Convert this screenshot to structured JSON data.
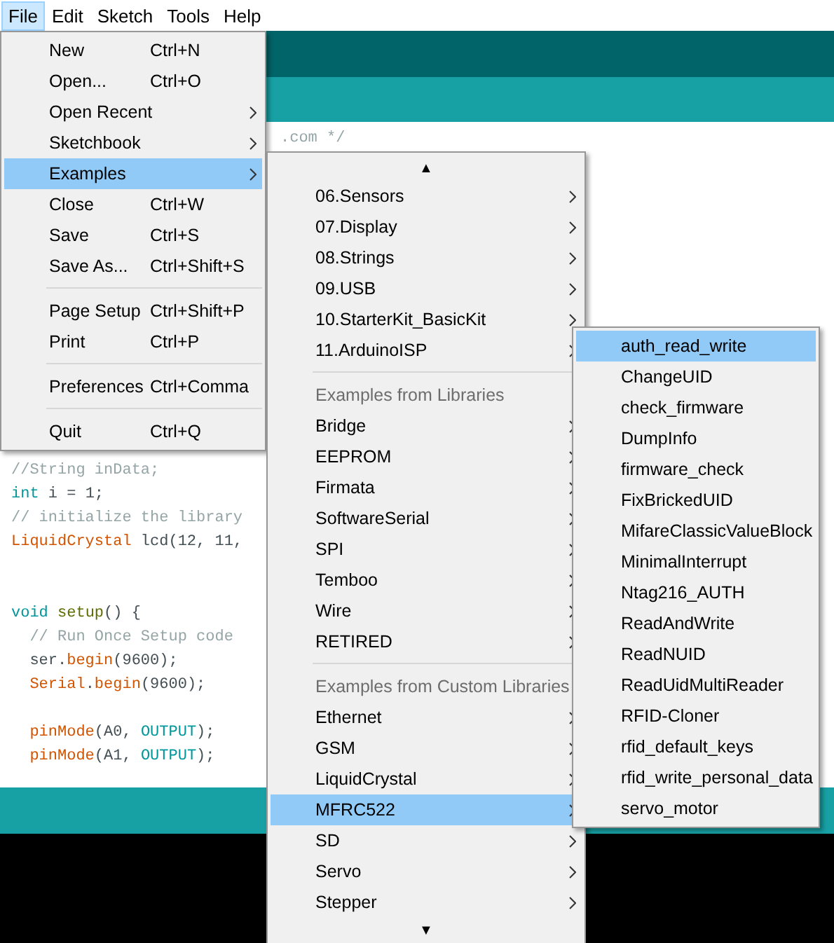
{
  "menubar": [
    {
      "label": "File",
      "selected": true
    },
    {
      "label": "Edit",
      "selected": false
    },
    {
      "label": "Sketch",
      "selected": false
    },
    {
      "label": "Tools",
      "selected": false
    },
    {
      "label": "Help",
      "selected": false
    }
  ],
  "editor": {
    "top_line": [
      {
        "kind": "comment",
        "text": ".com */"
      }
    ],
    "lines": [
      {
        "kind": "code",
        "tokens": [
          {
            "kind": "comment",
            "text": "//String inData;"
          }
        ]
      },
      {
        "kind": "code",
        "tokens": [
          {
            "kind": "keyword",
            "text": "int"
          },
          {
            "kind": "plain",
            "text": " i = 1;"
          }
        ]
      },
      {
        "kind": "code",
        "tokens": [
          {
            "kind": "comment",
            "text": "// initialize the library"
          }
        ]
      },
      {
        "kind": "code",
        "tokens": [
          {
            "kind": "class",
            "text": "LiquidCrystal"
          },
          {
            "kind": "plain",
            "text": " lcd(12, 11,"
          }
        ]
      },
      {
        "kind": "blank"
      },
      {
        "kind": "blank"
      },
      {
        "kind": "code",
        "tokens": [
          {
            "kind": "keyword",
            "text": "void "
          },
          {
            "kind": "function",
            "text": "setup"
          },
          {
            "kind": "plain",
            "text": "() {"
          }
        ]
      },
      {
        "kind": "code",
        "tokens": [
          {
            "kind": "comment",
            "text": "  // Run Once Setup code"
          }
        ]
      },
      {
        "kind": "code",
        "tokens": [
          {
            "kind": "plain",
            "text": "  ser."
          },
          {
            "kind": "class",
            "text": "begin"
          },
          {
            "kind": "plain",
            "text": "(9600);"
          }
        ]
      },
      {
        "kind": "code",
        "tokens": [
          {
            "kind": "class",
            "text": "  Serial"
          },
          {
            "kind": "plain",
            "text": "."
          },
          {
            "kind": "class",
            "text": "begin"
          },
          {
            "kind": "plain",
            "text": "(9600);"
          }
        ]
      },
      {
        "kind": "blank"
      },
      {
        "kind": "code",
        "tokens": [
          {
            "kind": "class",
            "text": "  pinMode"
          },
          {
            "kind": "plain",
            "text": "(A0, "
          },
          {
            "kind": "keyword",
            "text": "OUTPUT"
          },
          {
            "kind": "plain",
            "text": ");"
          }
        ]
      },
      {
        "kind": "code",
        "tokens": [
          {
            "kind": "class",
            "text": "  pinMode"
          },
          {
            "kind": "plain",
            "text": "(A1, "
          },
          {
            "kind": "keyword",
            "text": "OUTPUT"
          },
          {
            "kind": "plain",
            "text": ");"
          }
        ]
      }
    ]
  },
  "file_menu": {
    "items": [
      {
        "kind": "item",
        "label": "New",
        "shortcut": "Ctrl+N",
        "submenu": false,
        "selected": false
      },
      {
        "kind": "item",
        "label": "Open...",
        "shortcut": "Ctrl+O",
        "submenu": false,
        "selected": false
      },
      {
        "kind": "item",
        "label": "Open Recent",
        "submenu": true,
        "selected": false
      },
      {
        "kind": "item",
        "label": "Sketchbook",
        "submenu": true,
        "selected": false
      },
      {
        "kind": "item",
        "label": "Examples",
        "submenu": true,
        "selected": true
      },
      {
        "kind": "item",
        "label": "Close",
        "shortcut": "Ctrl+W",
        "submenu": false,
        "selected": false
      },
      {
        "kind": "item",
        "label": "Save",
        "shortcut": "Ctrl+S",
        "submenu": false,
        "selected": false
      },
      {
        "kind": "item",
        "label": "Save As...",
        "shortcut": "Ctrl+Shift+S",
        "submenu": false,
        "selected": false
      },
      {
        "kind": "separator"
      },
      {
        "kind": "item",
        "label": "Page Setup",
        "shortcut": "Ctrl+Shift+P",
        "submenu": false,
        "selected": false
      },
      {
        "kind": "item",
        "label": "Print",
        "shortcut": "Ctrl+P",
        "submenu": false,
        "selected": false
      },
      {
        "kind": "separator"
      },
      {
        "kind": "item",
        "label": "Preferences",
        "shortcut": "Ctrl+Comma",
        "submenu": false,
        "selected": false
      },
      {
        "kind": "separator"
      },
      {
        "kind": "item",
        "label": "Quit",
        "shortcut": "Ctrl+Q",
        "submenu": false,
        "selected": false
      }
    ]
  },
  "examples_menu": {
    "items": [
      {
        "kind": "scroll",
        "label": "▲"
      },
      {
        "kind": "item",
        "label": "06.Sensors",
        "submenu": true,
        "selected": false
      },
      {
        "kind": "item",
        "label": "07.Display",
        "submenu": true,
        "selected": false
      },
      {
        "kind": "item",
        "label": "08.Strings",
        "submenu": true,
        "selected": false
      },
      {
        "kind": "item",
        "label": "09.USB",
        "submenu": true,
        "selected": false
      },
      {
        "kind": "item",
        "label": "10.StarterKit_BasicKit",
        "submenu": true,
        "selected": false
      },
      {
        "kind": "item",
        "label": "11.ArduinoISP",
        "submenu": true,
        "selected": false
      },
      {
        "kind": "separator"
      },
      {
        "kind": "header",
        "label": "Examples from Libraries"
      },
      {
        "kind": "item",
        "label": "Bridge",
        "submenu": true,
        "selected": false
      },
      {
        "kind": "item",
        "label": "EEPROM",
        "submenu": true,
        "selected": false
      },
      {
        "kind": "item",
        "label": "Firmata",
        "submenu": true,
        "selected": false
      },
      {
        "kind": "item",
        "label": "SoftwareSerial",
        "submenu": true,
        "selected": false
      },
      {
        "kind": "item",
        "label": "SPI",
        "submenu": true,
        "selected": false
      },
      {
        "kind": "item",
        "label": "Temboo",
        "submenu": true,
        "selected": false
      },
      {
        "kind": "item",
        "label": "Wire",
        "submenu": true,
        "selected": false
      },
      {
        "kind": "item",
        "label": "RETIRED",
        "submenu": true,
        "selected": false
      },
      {
        "kind": "separator"
      },
      {
        "kind": "header",
        "label": "Examples from Custom Libraries"
      },
      {
        "kind": "item",
        "label": "Ethernet",
        "submenu": true,
        "selected": false
      },
      {
        "kind": "item",
        "label": "GSM",
        "submenu": true,
        "selected": false
      },
      {
        "kind": "item",
        "label": "LiquidCrystal",
        "submenu": true,
        "selected": false
      },
      {
        "kind": "item",
        "label": "MFRC522",
        "submenu": true,
        "selected": true
      },
      {
        "kind": "item",
        "label": "SD",
        "submenu": true,
        "selected": false
      },
      {
        "kind": "item",
        "label": "Servo",
        "submenu": true,
        "selected": false
      },
      {
        "kind": "item",
        "label": "Stepper",
        "submenu": true,
        "selected": false
      },
      {
        "kind": "scroll",
        "label": "▼"
      }
    ]
  },
  "mfrc522_menu": {
    "items": [
      {
        "kind": "item",
        "label": "auth_read_write",
        "submenu": false,
        "selected": true
      },
      {
        "kind": "item",
        "label": "ChangeUID",
        "submenu": false,
        "selected": false
      },
      {
        "kind": "item",
        "label": "check_firmware",
        "submenu": false,
        "selected": false
      },
      {
        "kind": "item",
        "label": "DumpInfo",
        "submenu": false,
        "selected": false
      },
      {
        "kind": "item",
        "label": "firmware_check",
        "submenu": false,
        "selected": false
      },
      {
        "kind": "item",
        "label": "FixBrickedUID",
        "submenu": false,
        "selected": false
      },
      {
        "kind": "item",
        "label": "MifareClassicValueBlock",
        "submenu": false,
        "selected": false
      },
      {
        "kind": "item",
        "label": "MinimalInterrupt",
        "submenu": false,
        "selected": false
      },
      {
        "kind": "item",
        "label": "Ntag216_AUTH",
        "submenu": false,
        "selected": false
      },
      {
        "kind": "item",
        "label": "ReadAndWrite",
        "submenu": false,
        "selected": false
      },
      {
        "kind": "item",
        "label": "ReadNUID",
        "submenu": false,
        "selected": false
      },
      {
        "kind": "item",
        "label": "ReadUidMultiReader",
        "submenu": false,
        "selected": false
      },
      {
        "kind": "item",
        "label": "RFID-Cloner",
        "submenu": false,
        "selected": false
      },
      {
        "kind": "item",
        "label": "rfid_default_keys",
        "submenu": false,
        "selected": false
      },
      {
        "kind": "item",
        "label": "rfid_write_personal_data",
        "submenu": false,
        "selected": false
      },
      {
        "kind": "item",
        "label": "servo_motor",
        "submenu": false,
        "selected": false
      }
    ]
  }
}
